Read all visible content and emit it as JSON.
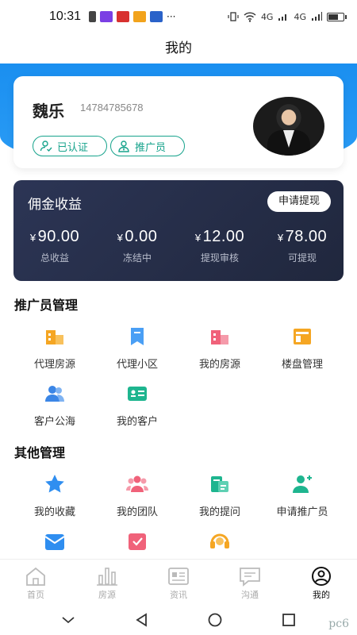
{
  "status_bar": {
    "time": "10:31",
    "signal_label": "4G"
  },
  "header": {
    "title": "我的"
  },
  "profile": {
    "name": "魏乐",
    "phone": "14784785678",
    "tags": [
      "已认证",
      "推广员"
    ]
  },
  "commission": {
    "title": "佣金收益",
    "withdraw_label": "申请提现",
    "currency": "¥",
    "stats": [
      {
        "value": "90.00",
        "label": "总收益"
      },
      {
        "value": "0.00",
        "label": "冻结中"
      },
      {
        "value": "12.00",
        "label": "提现审核"
      },
      {
        "value": "78.00",
        "label": "可提现"
      }
    ]
  },
  "promoter_section": {
    "title": "推广员管理",
    "items": [
      {
        "label": "代理房源",
        "icon": "building-icon",
        "color": "#f5a623"
      },
      {
        "label": "代理小区",
        "icon": "bookmark-icon",
        "color": "#4a9ff5"
      },
      {
        "label": "我的房源",
        "icon": "house-icon",
        "color": "#f0627a"
      },
      {
        "label": "楼盘管理",
        "icon": "layout-icon",
        "color": "#f5a623"
      },
      {
        "label": "客户公海",
        "icon": "users-icon",
        "color": "#3b86e6"
      },
      {
        "label": "我的客户",
        "icon": "id-card-icon",
        "color": "#1eb58f"
      }
    ]
  },
  "other_section": {
    "title": "其他管理",
    "items": [
      {
        "label": "我的收藏",
        "icon": "star-icon",
        "color": "#2f8ef0"
      },
      {
        "label": "我的团队",
        "icon": "team-icon",
        "color": "#f0627a"
      },
      {
        "label": "我的提问",
        "icon": "question-doc-icon",
        "color": "#1eb58f"
      },
      {
        "label": "申请推广员",
        "icon": "add-user-icon",
        "color": "#1eb58f"
      },
      {
        "label": "",
        "icon": "mail-icon",
        "color": "#2f8ef0"
      },
      {
        "label": "",
        "icon": "check-doc-icon",
        "color": "#f0627a"
      },
      {
        "label": "",
        "icon": "headset-icon",
        "color": "#f5a623"
      }
    ]
  },
  "bottom_nav": [
    {
      "label": "首页",
      "icon": "home-icon",
      "active": false
    },
    {
      "label": "房源",
      "icon": "chart-icon",
      "active": false
    },
    {
      "label": "资讯",
      "icon": "news-icon",
      "active": false
    },
    {
      "label": "沟通",
      "icon": "chat-icon",
      "active": false
    },
    {
      "label": "我的",
      "icon": "profile-icon",
      "active": true
    }
  ],
  "watermark": "pc6"
}
